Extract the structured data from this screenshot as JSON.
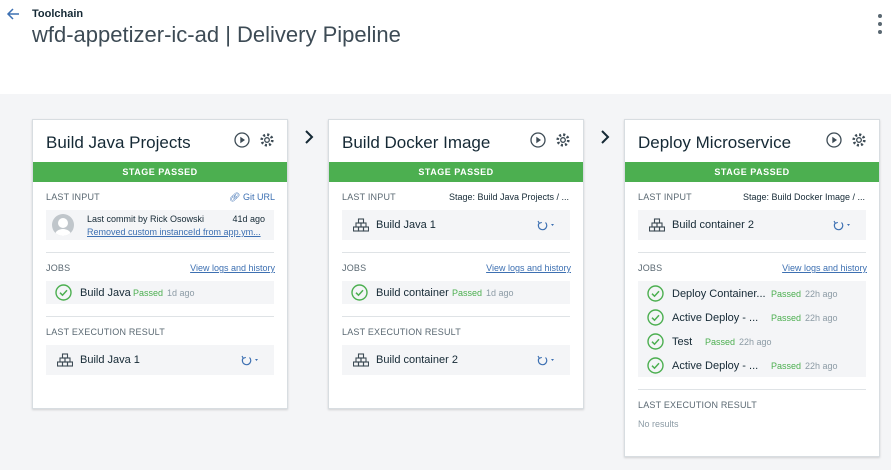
{
  "header": {
    "breadcrumb": "Toolchain",
    "title": "wfd-appetizer-ic-ad | Delivery Pipeline"
  },
  "stage_status": "STAGE PASSED",
  "labels": {
    "last_input": "LAST INPUT",
    "jobs": "JOBS",
    "last_execution": "LAST EXECUTION RESULT",
    "view_logs": "View logs and history",
    "passed": "Passed"
  },
  "stages": [
    {
      "name": "Build Java Projects",
      "input_link": "Git URL",
      "commit_by": "Last commit by Rick Osowski",
      "commit_age": "41d ago",
      "commit_msg": "Removed custom instanceId from app.ym...",
      "job": {
        "name": "Build Java",
        "age": "1d ago"
      },
      "result": "Build Java 1"
    },
    {
      "name": "Build Docker Image",
      "input_stage": "Stage: Build Java Projects  /  ...",
      "input_build": "Build Java 1",
      "job": {
        "name": "Build container",
        "age": "1d ago"
      },
      "result": "Build container 2"
    },
    {
      "name": "Deploy Microservice",
      "input_stage": "Stage: Build Docker Image  /  ...",
      "input_build": "Build container 2",
      "jobs": [
        {
          "name": "Deploy Container...",
          "age": "22h ago"
        },
        {
          "name": "Active Deploy - ...",
          "age": "22h ago"
        },
        {
          "name": "Test",
          "age": "22h ago"
        },
        {
          "name": "Active Deploy - ...",
          "age": "22h ago"
        }
      ],
      "result": "No results"
    }
  ]
}
